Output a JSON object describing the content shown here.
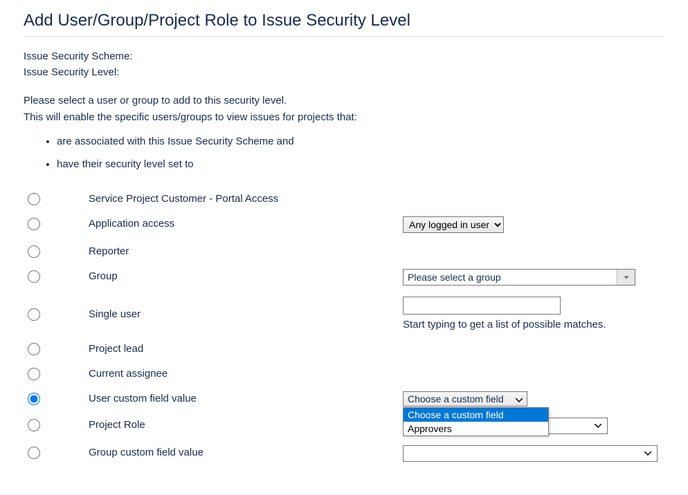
{
  "page": {
    "title": "Add User/Group/Project Role to Issue Security Level",
    "scheme_label": "Issue Security Scheme:",
    "level_label": "Issue Security Level:",
    "intro_line1": "Please select a user or group to add to this security level.",
    "intro_line2": "This will enable the specific users/groups to view issues for projects that:",
    "conditions": [
      "are associated with this Issue Security Scheme and",
      "have their security level set to"
    ]
  },
  "options": {
    "portal": {
      "label": "Service Project Customer - Portal Access"
    },
    "app_access": {
      "label": "Application access",
      "select_value": "Any logged in user"
    },
    "reporter": {
      "label": "Reporter"
    },
    "group": {
      "label": "Group",
      "select_value": "Please select a group"
    },
    "single_user": {
      "label": "Single user",
      "hint": "Start typing to get a list of possible matches."
    },
    "project_lead": {
      "label": "Project lead"
    },
    "current_assignee": {
      "label": "Current assignee"
    },
    "user_cf": {
      "label": "User custom field value",
      "select_value": "Choose a custom field",
      "dropdown_options": [
        "Choose a custom field",
        "Approvers"
      ]
    },
    "project_role": {
      "label": "Project Role",
      "select_value": ""
    },
    "group_cf": {
      "label": "Group custom field value",
      "select_value": ""
    }
  }
}
